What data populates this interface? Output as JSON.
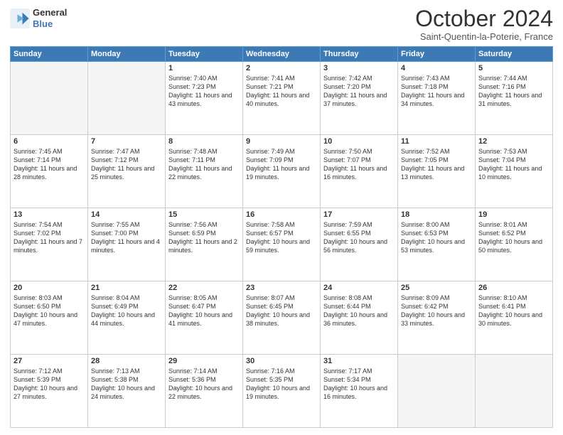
{
  "header": {
    "logo_line1": "General",
    "logo_line2": "Blue",
    "month": "October 2024",
    "location": "Saint-Quentin-la-Poterie, France"
  },
  "weekdays": [
    "Sunday",
    "Monday",
    "Tuesday",
    "Wednesday",
    "Thursday",
    "Friday",
    "Saturday"
  ],
  "weeks": [
    [
      {
        "day": "",
        "empty": true
      },
      {
        "day": "",
        "empty": true
      },
      {
        "day": "1",
        "sunrise": "7:40 AM",
        "sunset": "7:23 PM",
        "daylight": "11 hours and 43 minutes."
      },
      {
        "day": "2",
        "sunrise": "7:41 AM",
        "sunset": "7:21 PM",
        "daylight": "11 hours and 40 minutes."
      },
      {
        "day": "3",
        "sunrise": "7:42 AM",
        "sunset": "7:20 PM",
        "daylight": "11 hours and 37 minutes."
      },
      {
        "day": "4",
        "sunrise": "7:43 AM",
        "sunset": "7:18 PM",
        "daylight": "11 hours and 34 minutes."
      },
      {
        "day": "5",
        "sunrise": "7:44 AM",
        "sunset": "7:16 PM",
        "daylight": "11 hours and 31 minutes."
      }
    ],
    [
      {
        "day": "6",
        "sunrise": "7:45 AM",
        "sunset": "7:14 PM",
        "daylight": "11 hours and 28 minutes."
      },
      {
        "day": "7",
        "sunrise": "7:47 AM",
        "sunset": "7:12 PM",
        "daylight": "11 hours and 25 minutes."
      },
      {
        "day": "8",
        "sunrise": "7:48 AM",
        "sunset": "7:11 PM",
        "daylight": "11 hours and 22 minutes."
      },
      {
        "day": "9",
        "sunrise": "7:49 AM",
        "sunset": "7:09 PM",
        "daylight": "11 hours and 19 minutes."
      },
      {
        "day": "10",
        "sunrise": "7:50 AM",
        "sunset": "7:07 PM",
        "daylight": "11 hours and 16 minutes."
      },
      {
        "day": "11",
        "sunrise": "7:52 AM",
        "sunset": "7:05 PM",
        "daylight": "11 hours and 13 minutes."
      },
      {
        "day": "12",
        "sunrise": "7:53 AM",
        "sunset": "7:04 PM",
        "daylight": "11 hours and 10 minutes."
      }
    ],
    [
      {
        "day": "13",
        "sunrise": "7:54 AM",
        "sunset": "7:02 PM",
        "daylight": "11 hours and 7 minutes."
      },
      {
        "day": "14",
        "sunrise": "7:55 AM",
        "sunset": "7:00 PM",
        "daylight": "11 hours and 4 minutes."
      },
      {
        "day": "15",
        "sunrise": "7:56 AM",
        "sunset": "6:59 PM",
        "daylight": "11 hours and 2 minutes."
      },
      {
        "day": "16",
        "sunrise": "7:58 AM",
        "sunset": "6:57 PM",
        "daylight": "10 hours and 59 minutes."
      },
      {
        "day": "17",
        "sunrise": "7:59 AM",
        "sunset": "6:55 PM",
        "daylight": "10 hours and 56 minutes."
      },
      {
        "day": "18",
        "sunrise": "8:00 AM",
        "sunset": "6:53 PM",
        "daylight": "10 hours and 53 minutes."
      },
      {
        "day": "19",
        "sunrise": "8:01 AM",
        "sunset": "6:52 PM",
        "daylight": "10 hours and 50 minutes."
      }
    ],
    [
      {
        "day": "20",
        "sunrise": "8:03 AM",
        "sunset": "6:50 PM",
        "daylight": "10 hours and 47 minutes."
      },
      {
        "day": "21",
        "sunrise": "8:04 AM",
        "sunset": "6:49 PM",
        "daylight": "10 hours and 44 minutes."
      },
      {
        "day": "22",
        "sunrise": "8:05 AM",
        "sunset": "6:47 PM",
        "daylight": "10 hours and 41 minutes."
      },
      {
        "day": "23",
        "sunrise": "8:07 AM",
        "sunset": "6:45 PM",
        "daylight": "10 hours and 38 minutes."
      },
      {
        "day": "24",
        "sunrise": "8:08 AM",
        "sunset": "6:44 PM",
        "daylight": "10 hours and 36 minutes."
      },
      {
        "day": "25",
        "sunrise": "8:09 AM",
        "sunset": "6:42 PM",
        "daylight": "10 hours and 33 minutes."
      },
      {
        "day": "26",
        "sunrise": "8:10 AM",
        "sunset": "6:41 PM",
        "daylight": "10 hours and 30 minutes."
      }
    ],
    [
      {
        "day": "27",
        "sunrise": "7:12 AM",
        "sunset": "5:39 PM",
        "daylight": "10 hours and 27 minutes."
      },
      {
        "day": "28",
        "sunrise": "7:13 AM",
        "sunset": "5:38 PM",
        "daylight": "10 hours and 24 minutes."
      },
      {
        "day": "29",
        "sunrise": "7:14 AM",
        "sunset": "5:36 PM",
        "daylight": "10 hours and 22 minutes."
      },
      {
        "day": "30",
        "sunrise": "7:16 AM",
        "sunset": "5:35 PM",
        "daylight": "10 hours and 19 minutes."
      },
      {
        "day": "31",
        "sunrise": "7:17 AM",
        "sunset": "5:34 PM",
        "daylight": "10 hours and 16 minutes."
      },
      {
        "day": "",
        "empty": true
      },
      {
        "day": "",
        "empty": true
      }
    ]
  ]
}
